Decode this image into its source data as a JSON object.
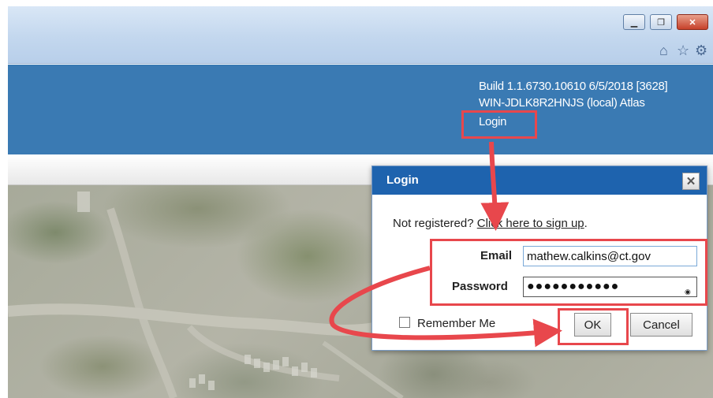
{
  "colors": {
    "header": "#3a7ab3",
    "dialog_title": "#1e63ae",
    "annotation": "#e8474c"
  },
  "browser": {
    "window_buttons": {
      "minimize": "minimize-icon",
      "restore": "restore-icon",
      "close": "close-icon"
    },
    "toolbar_icons": [
      "home-icon",
      "star-icon",
      "gear-icon"
    ]
  },
  "header": {
    "build": "Build 1.1.6730.10610 6/5/2018 [3628]",
    "server": "WIN-JDLK8R2HNJS (local) Atlas",
    "login_link": "Login"
  },
  "dialog": {
    "title": "Login",
    "close_icon": "close-icon",
    "register_prompt": "Not registered?",
    "register_link": "Click here to sign up",
    "register_suffix": ".",
    "email_label": "Email",
    "email_value": "mathew.calkins@ct.gov",
    "password_label": "Password",
    "password_value": "●●●●●●●●●●●",
    "remember_label": "Remember Me",
    "ok_label": "OK",
    "cancel_label": "Cancel"
  }
}
